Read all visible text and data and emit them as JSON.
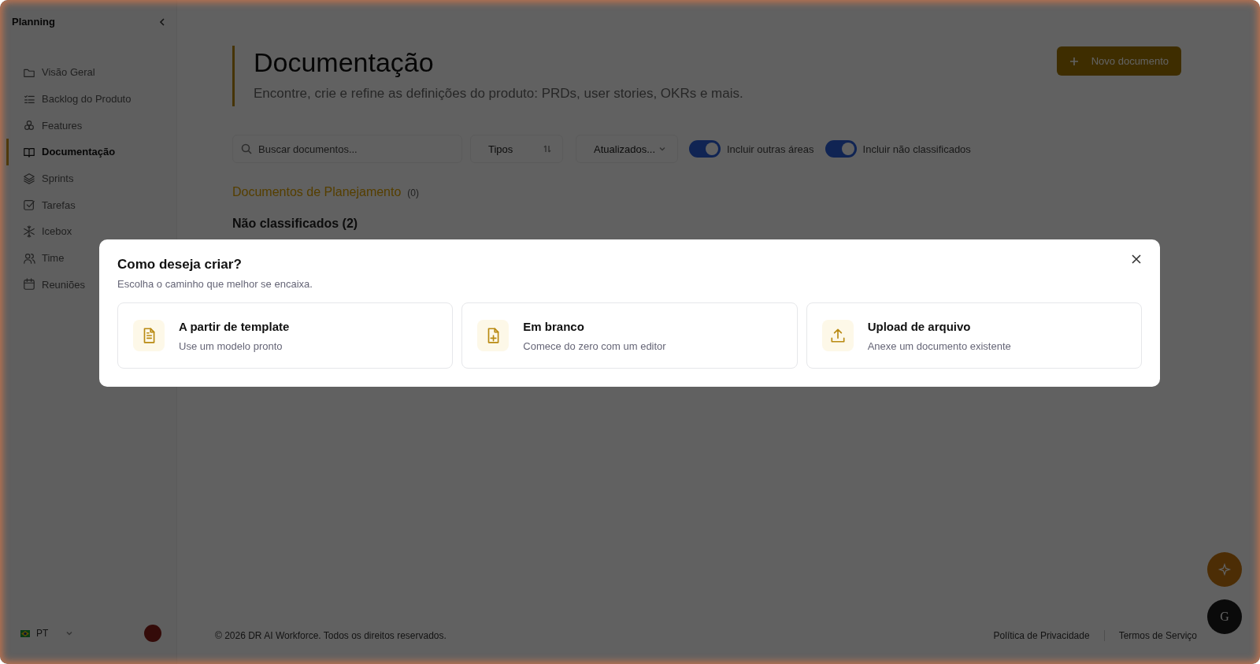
{
  "sidebar": {
    "title": "Planning",
    "items": [
      {
        "label": "Visão Geral",
        "selected": false
      },
      {
        "label": "Backlog do Produto",
        "selected": false
      },
      {
        "label": "Features",
        "selected": false
      },
      {
        "label": "Documentação",
        "selected": true
      },
      {
        "label": "Sprints",
        "selected": false
      },
      {
        "label": "Tarefas",
        "selected": false
      },
      {
        "label": "Icebox",
        "selected": false
      },
      {
        "label": "Time",
        "selected": false
      },
      {
        "label": "Reuniões",
        "selected": false
      }
    ]
  },
  "header": {
    "title": "Documentação",
    "subtitle": "Encontre, crie e refine as definições do produto: PRDs, user stories, OKRs e mais.",
    "button": "Novo documento"
  },
  "filters": {
    "search_placeholder": "Buscar documentos...",
    "types": "Tipos",
    "sort": "Atualizados...",
    "toggles": [
      {
        "label": "Incluir outras áreas",
        "on": true
      },
      {
        "label": "Incluir não classificados",
        "on": true
      }
    ]
  },
  "sections": [
    {
      "kind": "accent",
      "title": "Documentos de Planejamento",
      "count": "(0)"
    },
    {
      "kind": "plain",
      "title": "Não classificados (2)"
    }
  ],
  "modal": {
    "title": "Como deseja criar?",
    "subtitle": "Escolha o caminho que melhor se encaixa.",
    "options": [
      {
        "title": "A partir de template",
        "description": "Use um modelo pronto"
      },
      {
        "title": "Em branco",
        "description": "Comece do zero com um editor"
      },
      {
        "title": "Upload de arquivo",
        "description": "Anexe um documento existente"
      }
    ]
  },
  "footer": {
    "language": "PT",
    "copyright": "© 2026 DR AI Workforce. Todos os direitos reservados.",
    "links": [
      "Política de Privacidade",
      "Termos de Serviço"
    ]
  },
  "assistant": {
    "initial": "G"
  }
}
